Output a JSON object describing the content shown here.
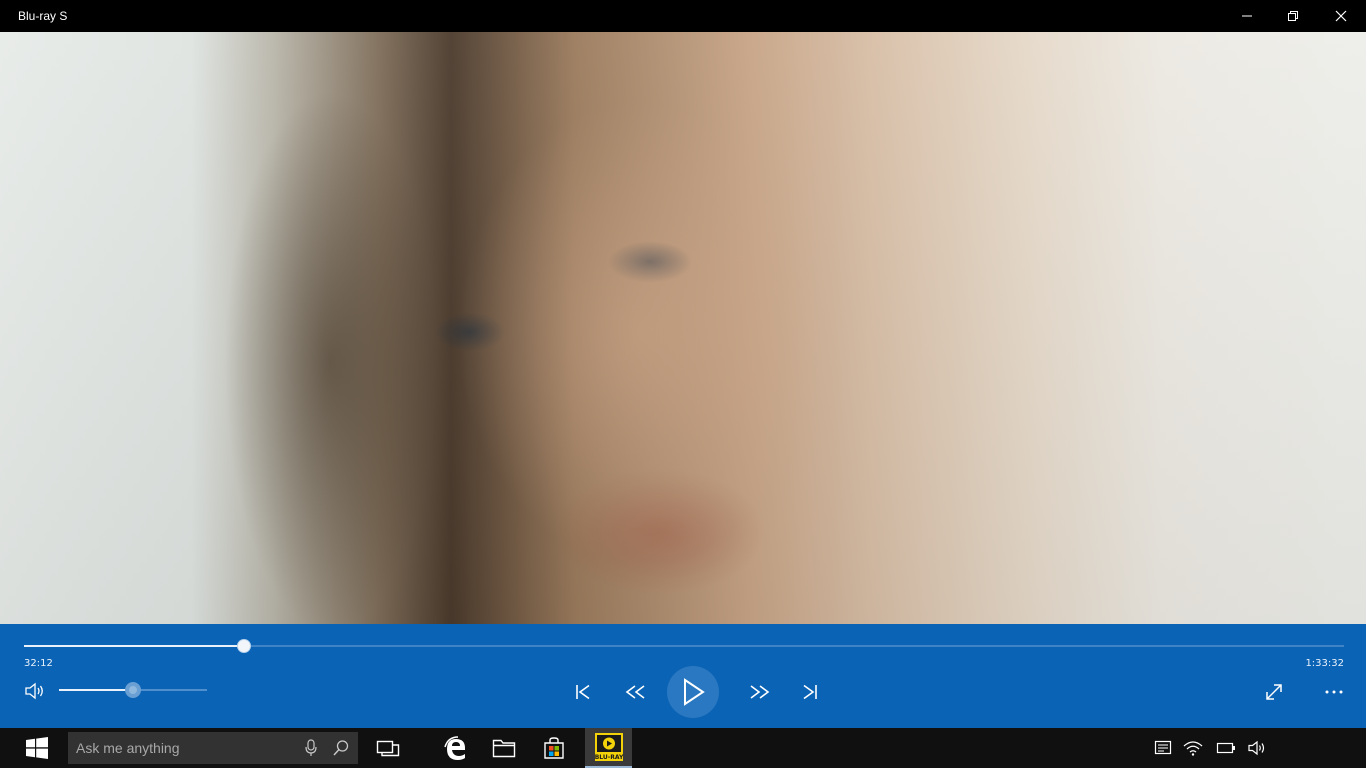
{
  "window": {
    "title": "Blu-ray S",
    "minimize_icon": "minimize-icon",
    "restore_icon": "restore-icon",
    "close_icon": "close-icon"
  },
  "player": {
    "progress": 0.167,
    "current_time": "32:12",
    "total_time": "1:33:32",
    "volume": 0.5,
    "accent_color": "#0a63b5",
    "buttons": {
      "volume_icon": "speaker-icon",
      "previous_icon": "skip-previous-icon",
      "rewind_icon": "rewind-icon",
      "play_icon": "play-icon",
      "fast_forward_icon": "fast-forward-icon",
      "next_icon": "skip-next-icon",
      "fullscreen_icon": "fullscreen-icon",
      "more_icon": "more-icon"
    }
  },
  "taskbar": {
    "start_icon": "windows-logo-icon",
    "search_placeholder": "Ask me anything",
    "pinned_icons": [
      "task-view-icon",
      "edge-icon",
      "file-explorer-icon",
      "store-icon",
      "blu-ray-app-icon"
    ],
    "active_app_label": "BLU-RAY",
    "tray_icons": [
      "notification-icon",
      "wifi-icon",
      "battery-icon",
      "volume-icon"
    ]
  }
}
